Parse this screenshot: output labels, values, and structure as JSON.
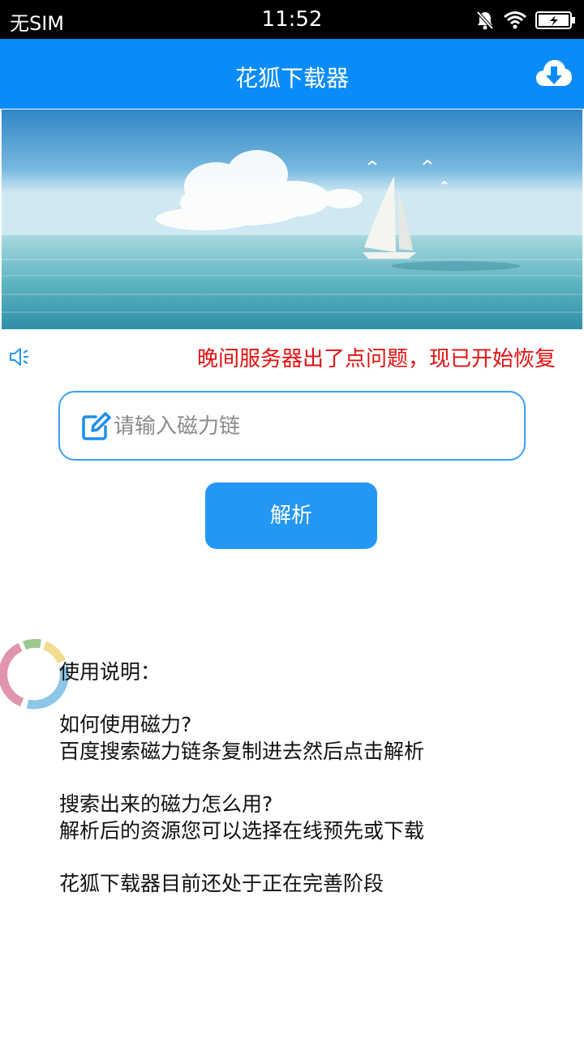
{
  "status_bar": {
    "carrier": "无SIM",
    "time": "11:52",
    "icons": [
      "bell-muted-icon",
      "wifi-icon",
      "battery-charging-icon"
    ]
  },
  "app_bar": {
    "title": "花狐下载器",
    "download_icon": "download-cloud-icon"
  },
  "banner": {
    "image": "sailboat-on-sea-banner"
  },
  "notice": {
    "icon": "speaker-icon",
    "text": "晚间服务器出了点问题，现已开始恢复"
  },
  "search": {
    "placeholder": "请输入磁力链",
    "value": "",
    "icon": "edit-icon"
  },
  "parse_button": {
    "label": "解析"
  },
  "instructions": {
    "heading": "使用说明：",
    "q1": "如何使用磁力?",
    "a1": "百度搜索磁力链条复制进去然后点击解析",
    "q2": "搜索出来的磁力怎么用?",
    "a2": "解析后的资源您可以选择在线预先或下载",
    "note": "花狐下载器目前还处于正在完善阶段"
  },
  "colors": {
    "primary": "#0a8cf8",
    "button": "#2497f4",
    "notice_text": "#e21010",
    "input_border": "#3d9ef0"
  }
}
